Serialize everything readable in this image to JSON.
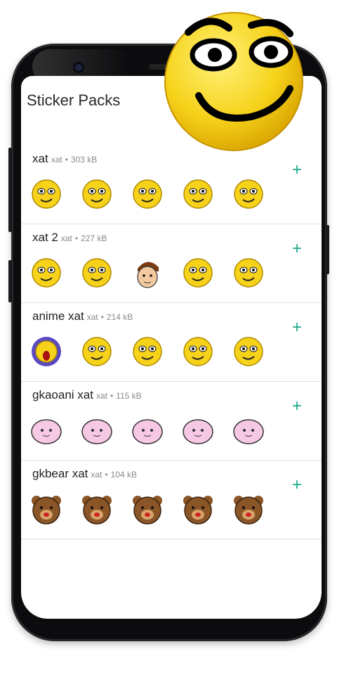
{
  "app": {
    "title": "Sticker Packs"
  },
  "packs": [
    {
      "name": "xat",
      "author": "xat",
      "size": "303 kB",
      "add": "+",
      "stickers": [
        "sleepy-face-icon",
        "smirk-face-icon",
        "angry-face-icon",
        "crying-face-icon",
        "worried-face-icon"
      ]
    },
    {
      "name": "xat 2",
      "author": "xat",
      "size": "227 kB",
      "add": "+",
      "stickers": [
        "cheeky-face-icon",
        "neutral-face-icon",
        "cartoon-boy-icon",
        "facepalm-face-icon",
        "raised-brow-face-icon"
      ]
    },
    {
      "name": "anime xat",
      "author": "xat",
      "size": "214 kB",
      "add": "+",
      "stickers": [
        "screaming-ghost-icon",
        "shocked-face-icon",
        "surprised-face-icon",
        "laughing-hand-face-icon",
        "dizzy-face-icon"
      ]
    },
    {
      "name": "gkaoani xat",
      "author": "xat",
      "size": "115 kB",
      "add": "+",
      "stickers": [
        "pink-smile-blob-icon",
        "pink-crying-blob-icon",
        "pink-glasses-blob-icon",
        "pink-happy-blob-icon",
        "pink-love-blob-icon"
      ]
    },
    {
      "name": "gkbear xat",
      "author": "xat",
      "size": "104 kB",
      "add": "+",
      "stickers": [
        "bear-shout-icon",
        "bear-yell-icon",
        "bear-dizzy-icon",
        "bear-sleepy-icon",
        "bear-wink-icon"
      ]
    }
  ],
  "colors": {
    "accent": "#1aa98c",
    "emoji_yellow": "#f6d21a",
    "blob_pink": "#f7c8e4",
    "bear_brown": "#8a5527"
  }
}
